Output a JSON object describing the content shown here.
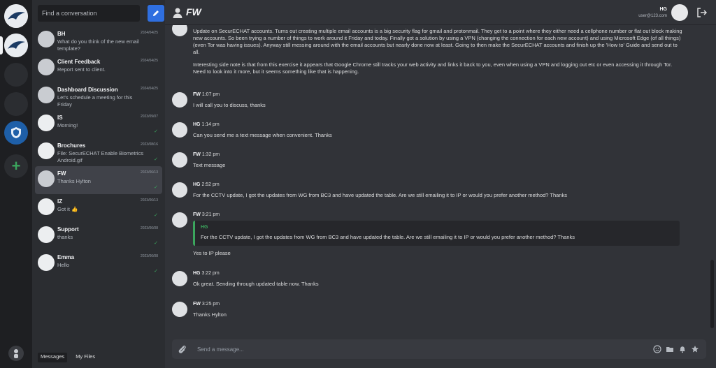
{
  "search": {
    "placeholder": "Find a conversation"
  },
  "header": {
    "title": "FW",
    "me_name": "HG",
    "me_email": "user@123.com"
  },
  "conversations": [
    {
      "name": "BH",
      "date": "2024/04/25",
      "preview": "What do you think of the new email template?",
      "tick": false,
      "active": false
    },
    {
      "name": "Client Feedback",
      "date": "2024/04/25",
      "preview": "Report sent to client.",
      "tick": false,
      "active": false
    },
    {
      "name": "Dashboard Discussion",
      "date": "2024/04/25",
      "preview": "Let's schedule a meeting for this Friday",
      "tick": false,
      "active": false
    },
    {
      "name": "IS",
      "date": "2023/09/07",
      "preview": "Morning!",
      "tick": true,
      "active": false
    },
    {
      "name": "Brochures",
      "date": "2023/08/16",
      "preview": "File: SecurECHAT Enable Biometrics Android.gif",
      "tick": true,
      "active": false
    },
    {
      "name": "FW",
      "date": "2023/06/13",
      "preview": "Thanks Hylton",
      "tick": true,
      "active": true
    },
    {
      "name": "IZ",
      "date": "2023/06/13",
      "preview": "Got it 👍",
      "tick": true,
      "active": false
    },
    {
      "name": "Support",
      "date": "2023/06/08",
      "preview": "thanks",
      "tick": true,
      "active": false
    },
    {
      "name": "Emma",
      "date": "2023/06/08",
      "preview": "Hello",
      "tick": true,
      "active": false
    }
  ],
  "tabs": {
    "messages": "Messages",
    "files": "My Files"
  },
  "messages": [
    {
      "name": "",
      "time": "",
      "text": "Update on SecurECHAT accounts. Turns out creating multiple email accounts is a big security flag for gmail and protonmail. They get to a point where they either need a cellphone number or flat out block making new accounts. So been trying a number of things to work around it Friday and today. Finally got a solution by using a VPN (changing the connection for each new account) and using Microsoft Edge (of all things) (even Tor was having issues). Anyway still messing around with the email accounts but nearly done now at least. Going to then make the SecurECHAT accounts and finish up the 'How to' Guide and send out to all.",
      "text2": "Interesting side note is that from this exercise it appears that Google Chrome still tracks your web activity and links it back to you, even when using a VPN and logging out etc or even accessing it through Tor. Need to look into it more, but it seems something like that is happening."
    },
    {
      "name": "FW",
      "time": "1:07 pm",
      "text": "I will call you to discuss, thanks"
    },
    {
      "name": "HG",
      "time": "1:14 pm",
      "text": "Can you send me a text message when convenient. Thanks"
    },
    {
      "name": "FW",
      "time": "1:32 pm",
      "text": "Text message"
    },
    {
      "name": "HG",
      "time": "2:52 pm",
      "text": "For the CCTV update, I got the updates from WG from BC3 and have updated the table. Are we still emailing it to IP or would you prefer another method? Thanks"
    },
    {
      "name": "FW",
      "time": "3:21 pm",
      "quote_name": "HG",
      "quote_text": "For the CCTV update, I got the updates from WG from BC3 and have updated the table. Are we still emailing it to IP or would you prefer another method? Thanks",
      "text": "Yes to IP please"
    },
    {
      "name": "HG",
      "time": "3:22 pm",
      "text": "Ok great. Sending through updated table now. Thanks"
    },
    {
      "name": "FW",
      "time": "3:25 pm",
      "text": "Thanks Hylton"
    }
  ],
  "composer": {
    "placeholder": "Send a message..."
  },
  "colors": {
    "accent": "#2f6fe0",
    "success": "#3ba55d",
    "bg": "#313338",
    "sidebar": "#2b2d31"
  }
}
